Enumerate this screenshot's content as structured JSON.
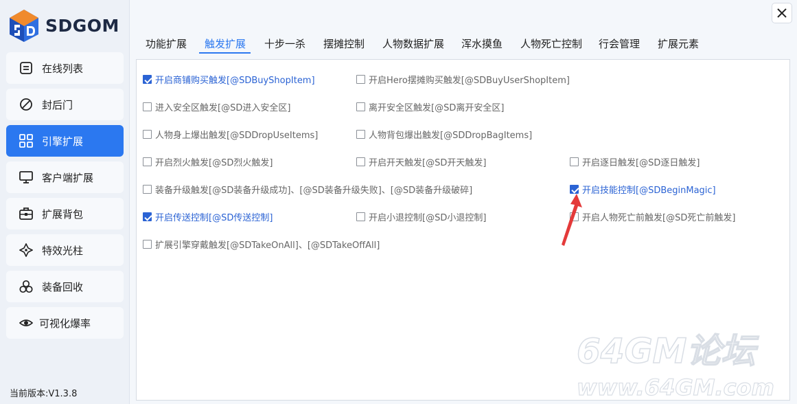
{
  "app": {
    "logo_text": "SDGOM",
    "version": "当前版本:V1.3.8"
  },
  "colors": {
    "accent": "#2b78f0",
    "checked_text": "#2b63d4",
    "arrow": "#e43a3a"
  },
  "sidebar": {
    "items": [
      {
        "label": "在线列表",
        "icon": "list-icon",
        "active": false
      },
      {
        "label": "封后门",
        "icon": "ban-icon",
        "active": false
      },
      {
        "label": "引擎扩展",
        "icon": "grid-icon",
        "active": true
      },
      {
        "label": "客户端扩展",
        "icon": "monitor-icon",
        "active": false
      },
      {
        "label": "扩展背包",
        "icon": "bag-icon",
        "active": false
      },
      {
        "label": "特效光柱",
        "icon": "sparkle-icon",
        "active": false
      },
      {
        "label": "装备回收",
        "icon": "recycle-icon",
        "active": false
      },
      {
        "label": "可视化爆率",
        "icon": "eye-icon",
        "active": false
      }
    ]
  },
  "tabs": [
    {
      "label": "功能扩展",
      "active": false
    },
    {
      "label": "触发扩展",
      "active": true
    },
    {
      "label": "十步一杀",
      "active": false
    },
    {
      "label": "摆摊控制",
      "active": false
    },
    {
      "label": "人物数据扩展",
      "active": false
    },
    {
      "label": "浑水摸鱼",
      "active": false
    },
    {
      "label": "人物死亡控制",
      "active": false
    },
    {
      "label": "行会管理",
      "active": false
    },
    {
      "label": "扩展元素",
      "active": false
    }
  ],
  "options": [
    {
      "label": "开启商铺购买触发[@SDBuyShopItem]",
      "checked": true
    },
    {
      "label": "开启Hero摆摊购买触发[@SDBuyUserShopItem]",
      "checked": false
    },
    {
      "label": "进入安全区触发[@SD进入安全区]",
      "checked": false
    },
    {
      "label": "离开安全区触发[@SD离开安全区]",
      "checked": false
    },
    {
      "label": "人物身上爆出触发[@SDDropUseItems]",
      "checked": false
    },
    {
      "label": "人物背包爆出触发[@SDDropBagItems]",
      "checked": false
    },
    {
      "label": "开启烈火触发[@SD烈火触发]",
      "checked": false
    },
    {
      "label": "开启开天触发[@SD开天触发]",
      "checked": false
    },
    {
      "label": "开启逐日触发[@SD逐日触发]",
      "checked": false
    },
    {
      "label": "装备升级触发[@SD装备升级成功]、[@SD装备升级失败]、[@SD装备升级破碎]",
      "checked": false
    },
    {
      "label": "开启技能控制[@SDBeginMagic]",
      "checked": true
    },
    {
      "label": "开启传送控制[@SD传送控制]",
      "checked": true
    },
    {
      "label": "开启小退控制[@SD小退控制]",
      "checked": false
    },
    {
      "label": "开启人物死亡前触发[@SD死亡前触发]",
      "checked": false
    },
    {
      "label": "扩展引擎穿戴触发[@SDTakeOnAll]、[@SDTakeOffAll]",
      "checked": false
    }
  ],
  "watermark": {
    "line1": "64GM论坛",
    "line2": "www.64GM.com"
  }
}
